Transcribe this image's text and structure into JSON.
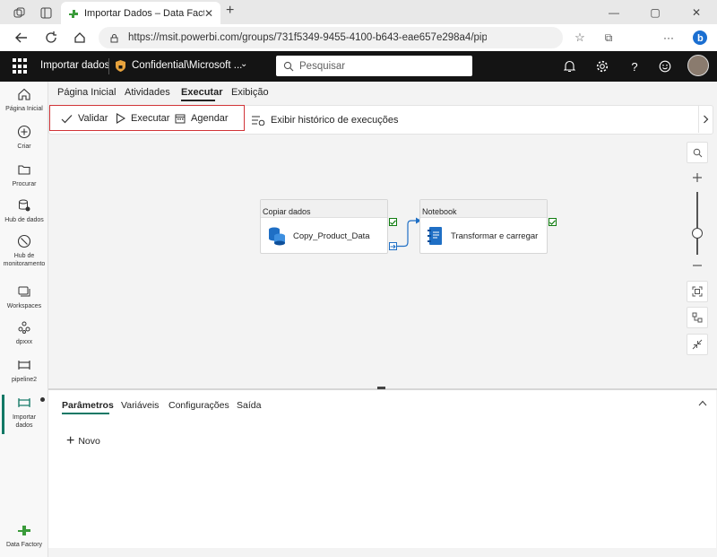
{
  "browser": {
    "tab_title": "Importar Dados – Data Factory",
    "new_tab_symbol": "+",
    "url": "https://msit.powerbi.com/groups/731f5349-9455-4100-b643-eae657e298a4/pip..."
  },
  "app": {
    "title": "Importar dados",
    "sensitivity_label": "Confidential\\Microsoft ...",
    "search_placeholder": "Pesquisar",
    "accent_color": "#117865",
    "highlight_color": "#d13438"
  },
  "rail": {
    "items": [
      {
        "label": "Página Inicial",
        "icon": "home-icon"
      },
      {
        "label": "Criar",
        "icon": "plus-circle-icon"
      },
      {
        "label": "Procurar",
        "icon": "folder-icon"
      },
      {
        "label": "Hub de dados",
        "icon": "database-icon"
      },
      {
        "label": "Hub de monitoramento",
        "icon": "monitor-icon"
      },
      {
        "label": "Workspaces",
        "icon": "workspaces-icon"
      },
      {
        "label": "dpxxx",
        "icon": "dataflow-icon"
      },
      {
        "label": "pipeline2",
        "icon": "pipeline-icon"
      },
      {
        "label": "Importar dados",
        "icon": "pipeline-icon"
      }
    ],
    "footer_label": "Data Factory"
  },
  "ribbon": {
    "tabs": [
      "Página Inicial",
      "Atividades",
      "Executar",
      "Exibição"
    ],
    "active_tab": "Executar"
  },
  "toolbar": {
    "validate": "Validar",
    "run": "Executar",
    "schedule": "Agendar",
    "history": "Exibir histórico de execuções"
  },
  "pipeline": {
    "activities": [
      {
        "type": "Copiar dados",
        "name": "Copy_Product_Data",
        "status": "succeeded"
      },
      {
        "type": "Notebook",
        "name": "Transformar e carregar",
        "status": "succeeded"
      }
    ]
  },
  "panel": {
    "tabs": [
      "Parâmetros",
      "Variáveis",
      "Configurações",
      "Saída"
    ],
    "active_tab": "Parâmetros",
    "new_label": "Novo"
  }
}
